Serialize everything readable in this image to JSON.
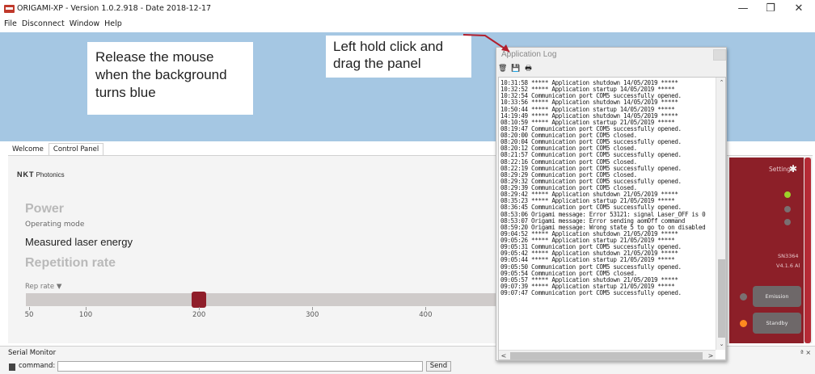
{
  "window": {
    "title": "ORIGAMI-XP - Version 1.0.2.918 - Date 2018-12-17",
    "minimize": "—",
    "maximize": "❐",
    "close": "✕"
  },
  "menu": [
    "File",
    "Disconnect",
    "Window",
    "Help"
  ],
  "notes": {
    "drop": "Release the mouse when the background turns blue",
    "drag": "Left hold click and drag the panel"
  },
  "tabs": [
    "Welcome",
    "Control Panel"
  ],
  "control_panel": {
    "logo": "NKT",
    "logo_sub": "Photonics",
    "power_title": "Power",
    "operating_mode": "Operating mode",
    "measured": "Measured laser energy",
    "rep_title": "Repetition rate",
    "rep_label": "Rep rate ▼",
    "slider_value": 200,
    "slider_min": 50,
    "slider_max": 450,
    "ticks": [
      "50",
      "100",
      "200",
      "300",
      "400"
    ]
  },
  "device": {
    "settings": "Settings",
    "serial": "SN3364",
    "version": "V4.1.6 Al",
    "emission": "Emission",
    "standby": "Standby",
    "led_colors": [
      "#9ed22a",
      "#7a6f71",
      "#7a6f71"
    ],
    "standby_led": "#ff8a1f",
    "emission_led": "#7a6f71"
  },
  "serial_monitor": {
    "title": "Serial Monitor",
    "command_label": "command:",
    "command_value": "",
    "send": "Send",
    "close": "ª ×"
  },
  "app_log": {
    "title": "Application Log",
    "tools": [
      "trash-icon",
      "save-icon",
      "print-icon"
    ],
    "lines": [
      "10:31:58 ***** Application shutdown 14/05/2019 *****",
      "10:32:52 ***** Application startup 14/05/2019 *****",
      "10:32:54 Communication port COM5 successfully opened.",
      "10:33:56 ***** Application shutdown 14/05/2019 *****",
      "10:50:44 ***** Application startup 14/05/2019 *****",
      "14:19:49 ***** Application shutdown 14/05/2019 *****",
      "08:10:59 ***** Application startup 21/05/2019 *****",
      "08:19:47 Communication port COM5 successfully opened.",
      "08:20:00 Communication port COM5 closed.",
      "08:20:04 Communication port COM5 successfully opened.",
      "08:20:12 Communication port COM5 closed.",
      "08:21:57 Communication port COM5 successfully opened.",
      "08:22:16 Communication port COM5 closed.",
      "08:22:19 Communication port COM5 successfully opened.",
      "08:29:29 Communication port COM5 closed.",
      "08:29:32 Communication port COM5 successfully opened.",
      "08:29:39 Communication port COM5 closed.",
      "08:29:42 ***** Application shutdown 21/05/2019 *****",
      "08:35:23 ***** Application startup 21/05/2019 *****",
      "08:36:45 Communication port COM5 successfully opened.",
      "08:53:06 Origami message: Error 53121: signal Laser_OFF is 0",
      "08:53:07 Origami message: Error sending aomOff command",
      "08:59:20 Origami message: Wrong state 5 to go to on disabled",
      "09:04:52 ***** Application shutdown 21/05/2019 *****",
      "09:05:26 ***** Application startup 21/05/2019 *****",
      "09:05:31 Communication port COM5 successfully opened.",
      "09:05:42 ***** Application shutdown 21/05/2019 *****",
      "09:05:44 ***** Application startup 21/05/2019 *****",
      "09:05:50 Communication port COM5 successfully opened.",
      "09:05:54 Communication port COM5 closed.",
      "09:05:57 ***** Application shutdown 21/05/2019 *****",
      "09:07:39 ***** Application startup 21/05/2019 *****",
      "09:07:47 Communication port COM5 successfully opened."
    ]
  }
}
